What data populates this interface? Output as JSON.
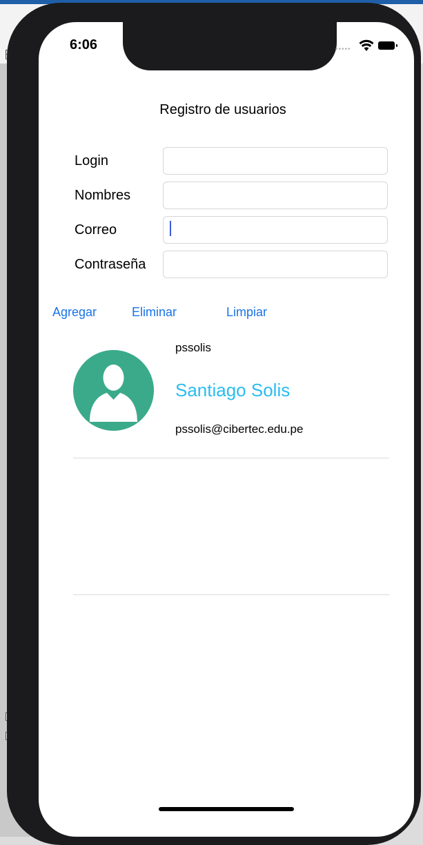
{
  "status_bar": {
    "time": "6:06"
  },
  "form": {
    "title": "Registro de usuarios",
    "fields": [
      {
        "label": "Login",
        "value": ""
      },
      {
        "label": "Nombres",
        "value": ""
      },
      {
        "label": "Correo",
        "value": ""
      },
      {
        "label": "Contraseña",
        "value": ""
      }
    ]
  },
  "actions": {
    "add_label": "Agregar",
    "delete_label": "Eliminar",
    "clear_label": "Limpiar"
  },
  "users": [
    {
      "login": "pssolis",
      "name": "Santiago Solis",
      "email": "pssolis@cibertec.edu.pe"
    }
  ],
  "colors": {
    "accent": "#1a73e8",
    "name_color": "#2bbcf0",
    "avatar_bg": "#3aaa8a"
  },
  "icons": {
    "avatar": "user-silhouette-icon",
    "wifi": "wifi-icon",
    "battery": "battery-icon"
  }
}
